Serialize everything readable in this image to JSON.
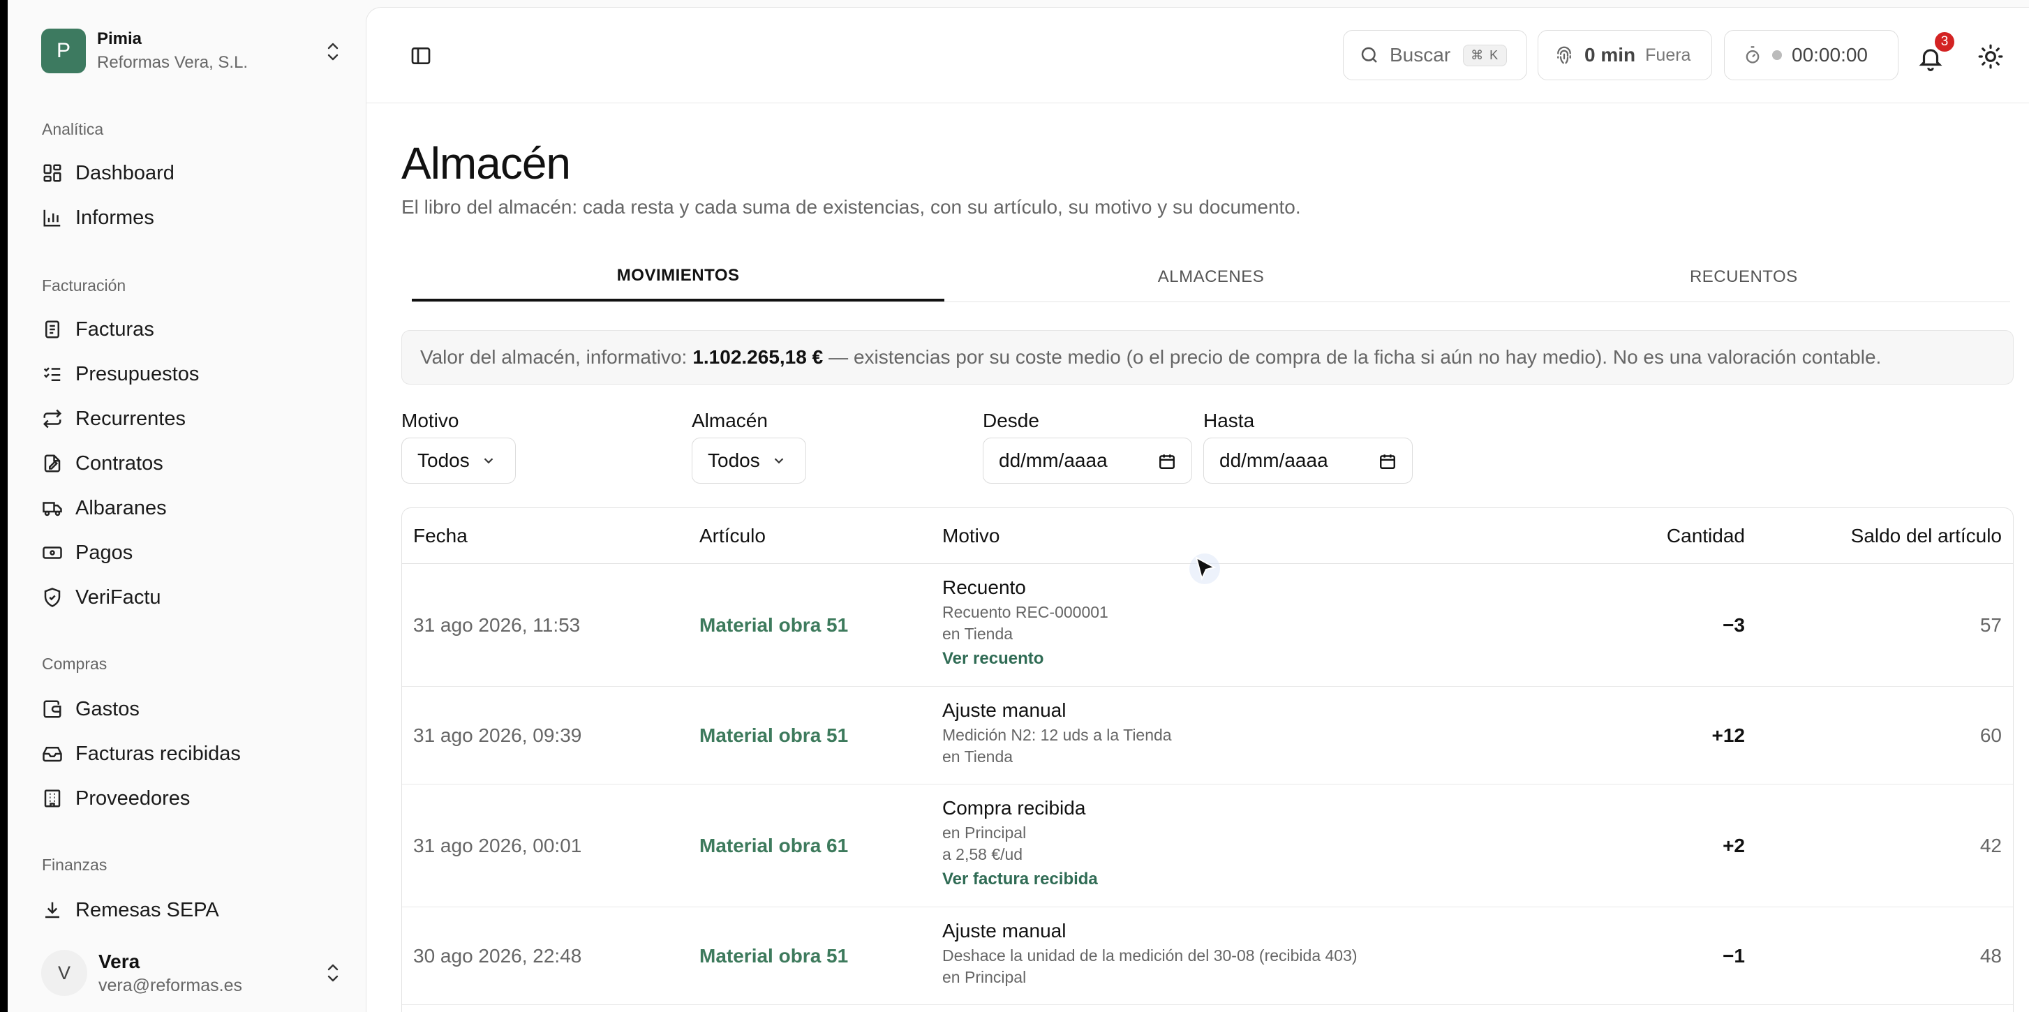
{
  "org": {
    "initial": "P",
    "name": "Pimia",
    "company": "Reformas Vera, S.L."
  },
  "sidebar": {
    "sections": [
      {
        "label": "Analítica",
        "items": [
          {
            "label": "Dashboard",
            "icon": "dashboard-icon"
          },
          {
            "label": "Informes",
            "icon": "chart-icon"
          }
        ]
      },
      {
        "label": "Facturación",
        "items": [
          {
            "label": "Facturas",
            "icon": "invoice-icon"
          },
          {
            "label": "Presupuestos",
            "icon": "checklist-icon"
          },
          {
            "label": "Recurrentes",
            "icon": "repeat-icon"
          },
          {
            "label": "Contratos",
            "icon": "contract-icon"
          },
          {
            "label": "Albaranes",
            "icon": "truck-icon"
          },
          {
            "label": "Pagos",
            "icon": "banknote-icon"
          },
          {
            "label": "VeriFactu",
            "icon": "shield-check-icon"
          }
        ]
      },
      {
        "label": "Compras",
        "items": [
          {
            "label": "Gastos",
            "icon": "wallet-icon"
          },
          {
            "label": "Facturas recibidas",
            "icon": "inbox-icon"
          },
          {
            "label": "Proveedores",
            "icon": "building-icon"
          }
        ]
      },
      {
        "label": "Finanzas",
        "items": [
          {
            "label": "Remesas SEPA",
            "icon": "download-icon"
          }
        ]
      }
    ]
  },
  "user": {
    "initial": "V",
    "name": "Vera",
    "email": "vera@reformas.es"
  },
  "topbar": {
    "search_placeholder": "Buscar",
    "search_shortcut": "⌘ K",
    "clock_value": "0 min",
    "clock_status": "Fuera",
    "timer_value": "00:00:00",
    "notifications_count": "3"
  },
  "page": {
    "title": "Almacén",
    "subtitle": "El libro del almacén: cada resta y cada suma de existencias, con su artículo, su motivo y su documento.",
    "tabs": [
      {
        "label": "MOVIMIENTOS",
        "active": true
      },
      {
        "label": "ALMACENES",
        "active": false
      },
      {
        "label": "RECUENTOS",
        "active": false
      }
    ],
    "info": {
      "prefix": "Valor del almacén, informativo:",
      "value": "1.102.265,18 €",
      "suffix": "— existencias por su coste medio (o el precio de compra de la ficha si aún no hay medio). No es una valoración contable."
    }
  },
  "filters": {
    "motivo": {
      "label": "Motivo",
      "value": "Todos"
    },
    "almacen": {
      "label": "Almacén",
      "value": "Todos"
    },
    "desde": {
      "label": "Desde",
      "value": "dd/mm/aaaa"
    },
    "hasta": {
      "label": "Hasta",
      "value": "dd/mm/aaaa"
    }
  },
  "table": {
    "headers": {
      "fecha": "Fecha",
      "articulo": "Artículo",
      "motivo": "Motivo",
      "cantidad": "Cantidad",
      "saldo": "Saldo del artículo"
    },
    "rows": [
      {
        "fecha": "31 ago 2026, 11:53",
        "articulo": "Material obra 51",
        "motivo": "Recuento",
        "line1": "Recuento REC-000001",
        "line2": "en Tienda",
        "link": "Ver recuento",
        "cantidad": "−3",
        "saldo": "57"
      },
      {
        "fecha": "31 ago 2026, 09:39",
        "articulo": "Material obra 51",
        "motivo": "Ajuste manual",
        "line1": "Medición N2: 12 uds a la Tienda",
        "line2": "en Tienda",
        "link": "",
        "cantidad": "+12",
        "saldo": "60"
      },
      {
        "fecha": "31 ago 2026, 00:01",
        "articulo": "Material obra 61",
        "motivo": "Compra recibida",
        "line1": "en Principal",
        "line2": "a 2,58 €/ud",
        "link": "Ver factura recibida",
        "cantidad": "+2",
        "saldo": "42"
      },
      {
        "fecha": "30 ago 2026, 22:48",
        "articulo": "Material obra 51",
        "motivo": "Ajuste manual",
        "line1": "Deshace la unidad de la medición del 30-08 (recibida 403)",
        "line2": "en Principal",
        "link": "",
        "cantidad": "−1",
        "saldo": "48"
      }
    ]
  },
  "colors": {
    "brand": "#3d7a60",
    "link": "#2f6b54",
    "badge": "#d32323"
  }
}
